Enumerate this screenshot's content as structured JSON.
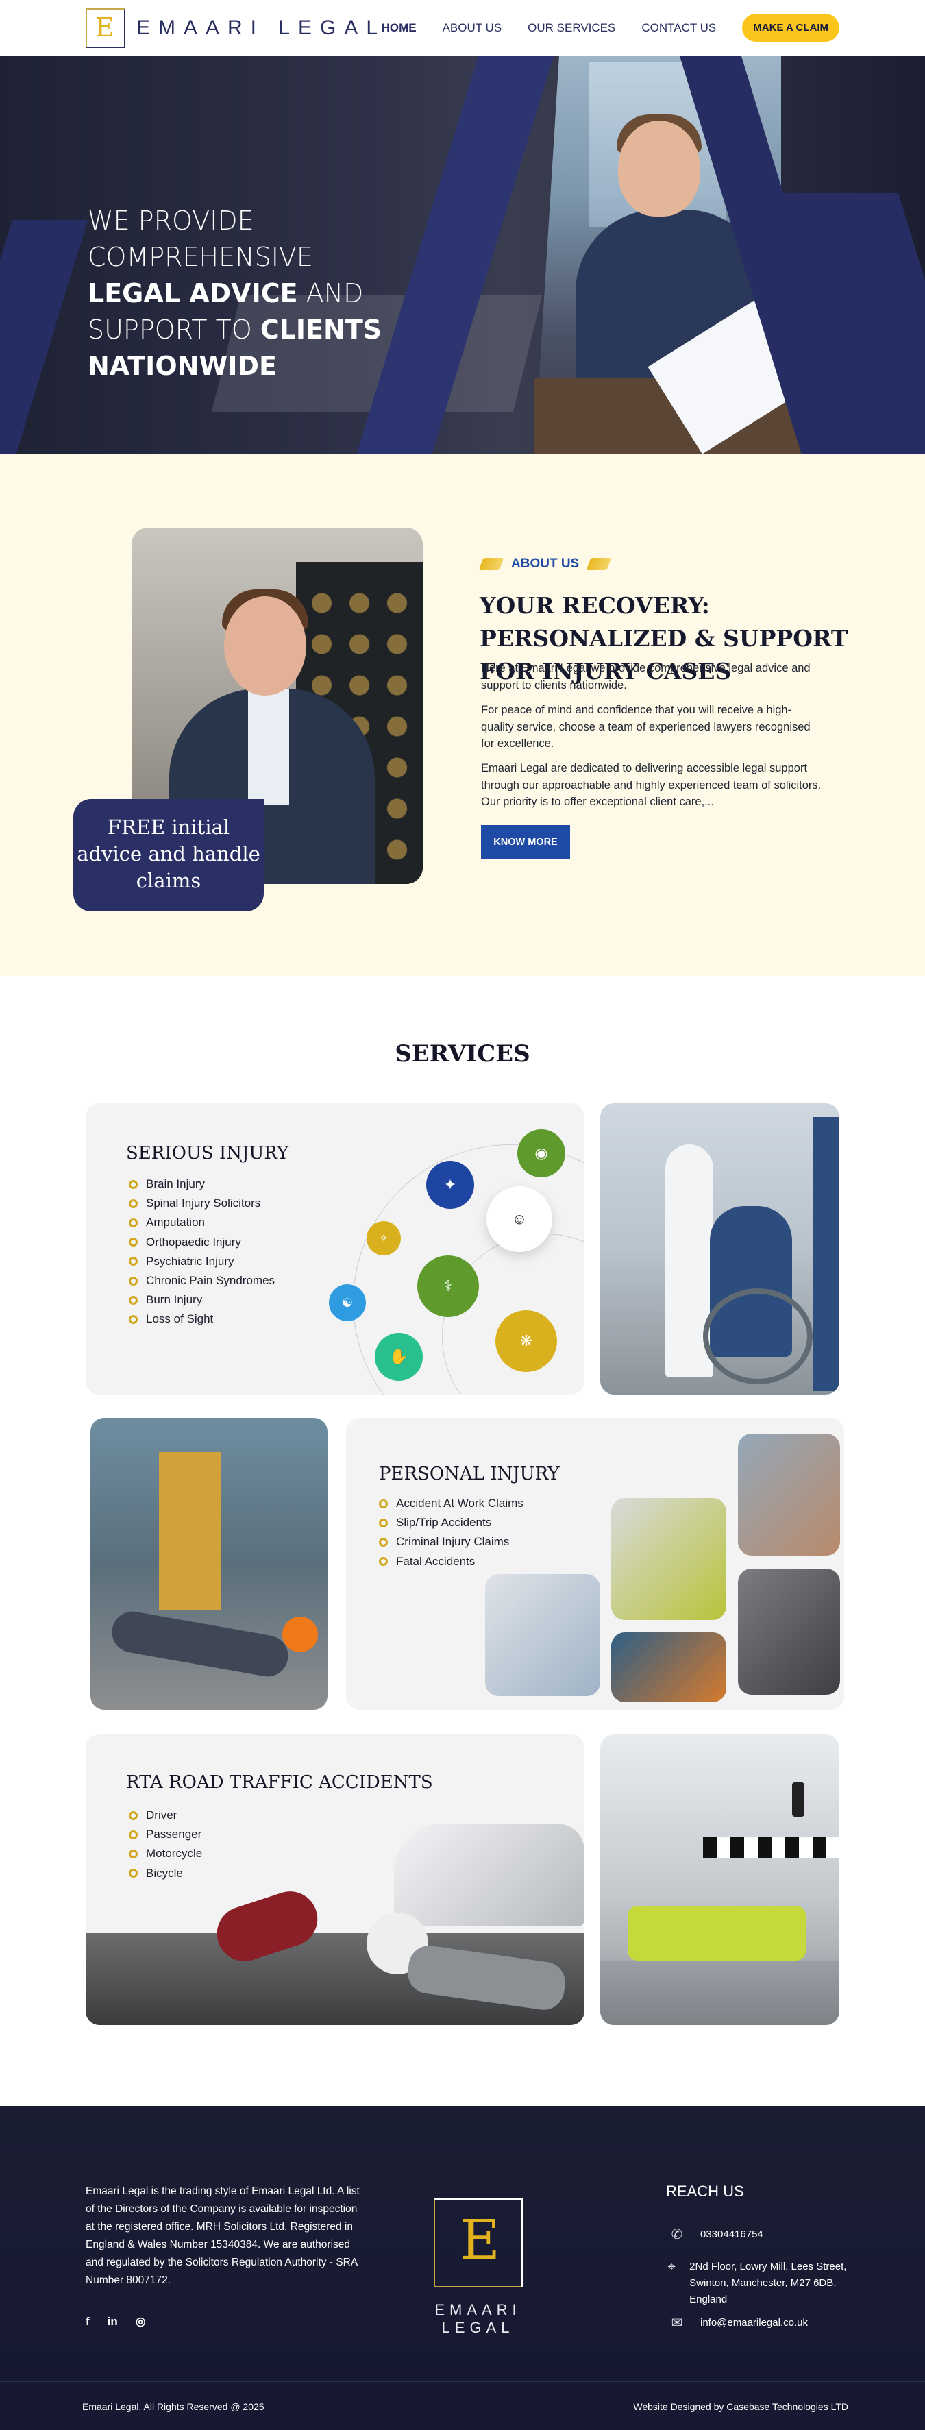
{
  "header": {
    "logo_letter": "E",
    "logo_text": "EMAARI LEGAL",
    "nav": [
      {
        "label": "HOME",
        "active": true
      },
      {
        "label": "ABOUT US"
      },
      {
        "label": "OUR SERVICES"
      },
      {
        "label": "CONTACT US"
      }
    ],
    "cta_label": "MAKE A CLAIM",
    "cta_color": "#fbc51b"
  },
  "hero": {
    "line1": "WE PROVIDE",
    "line2": "COMPREHENSIVE",
    "line3_bold": "LEGAL ADVICE",
    "line3_rest": " AND",
    "line4_rest": "SUPPORT TO ",
    "line4_bold": "CLIENTS",
    "line5_bold": "NATIONWIDE"
  },
  "about": {
    "badge": "FREE initial advice and handle claims",
    "kicker": "ABOUT US",
    "title": "YOUR RECOVERY: PERSONALIZED & SUPPORT FOR INJURY CASES",
    "p1": "Here at Emaari Legal we provide comprehensive legal advice and support to clients nationwide.",
    "p2": "For peace of mind and confidence that you will receive a high-quality service, choose a team of experienced lawyers recognised for excellence.",
    "p3": "Emaari Legal are dedicated to delivering accessible legal support through our approachable and highly experienced team of solicitors. Our priority is to offer exceptional client care,...",
    "button": "KNOW MORE",
    "accent": "#1f4aa6"
  },
  "services": {
    "title": "SERVICES",
    "serious": {
      "title": "SERIOUS INJURY",
      "items": [
        "Brain Injury",
        "Spinal Injury Solicitors",
        "Amputation",
        "Orthopaedic Injury",
        "Psychiatric Injury",
        "Chronic Pain Syndromes",
        "Burn Injury",
        "Loss of Sight"
      ]
    },
    "personal": {
      "title": "PERSONAL INJURY",
      "items": [
        "Accident At Work Claims",
        "Slip/Trip Accidents",
        "Criminal Injury Claims",
        "Fatal Accidents"
      ]
    },
    "rta": {
      "title": "RTA ROAD TRAFFIC ACCIDENTS",
      "items": [
        "Driver",
        "Passenger",
        "Motorcycle",
        "Bicycle"
      ]
    }
  },
  "footer": {
    "about": "Emaari Legal is the trading style of Emaari Legal Ltd. A list of the Directors of the Company is available for inspection at the registered office. MRH Solicitors Ltd, Registered in England & Wales Number 15340384. We are authorised and regulated by the Solicitors Regulation Authority - SRA Number 8007172.",
    "social": [
      "f",
      "in",
      "◎"
    ],
    "logo_letter": "E",
    "logo_text": "EMAARI LEGAL",
    "reach_title": "REACH US",
    "phone": "03304416754",
    "address": "2Nd Floor, Lowry Mill, Lees Street, Swinton, Manchester, M27 6DB, England",
    "email": "info@emaarilegal.co.uk",
    "copyright": "Emaari Legal. All Rights Reserved @ 2025",
    "designed_by": "Website Designed by Casebase Technologies LTD"
  }
}
